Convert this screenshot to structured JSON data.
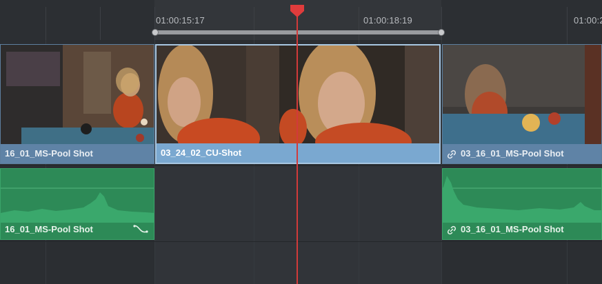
{
  "ruler": {
    "timecodes": [
      "01:00:15:17",
      "01:00:18:19",
      "01:00:2"
    ]
  },
  "video_clips": [
    {
      "name": "16_01_MS-Pool Shot",
      "linked": false,
      "selected": false
    },
    {
      "name": "03_24_02_CU-Shot",
      "linked": false,
      "selected": true
    },
    {
      "name": "03_16_01_MS-Pool Shot",
      "linked": true,
      "selected": false
    }
  ],
  "audio_clips": [
    {
      "name": "16_01_MS-Pool Shot",
      "linked": false,
      "has_fade_curve": true
    },
    {
      "name": "03_16_01_MS-Pool Shot",
      "linked": true
    }
  ],
  "colors": {
    "playhead": "#d23a3a",
    "video_clip": "#5f83a6",
    "video_clip_selected": "#7aa8d0",
    "audio_clip": "#2d8a57"
  }
}
